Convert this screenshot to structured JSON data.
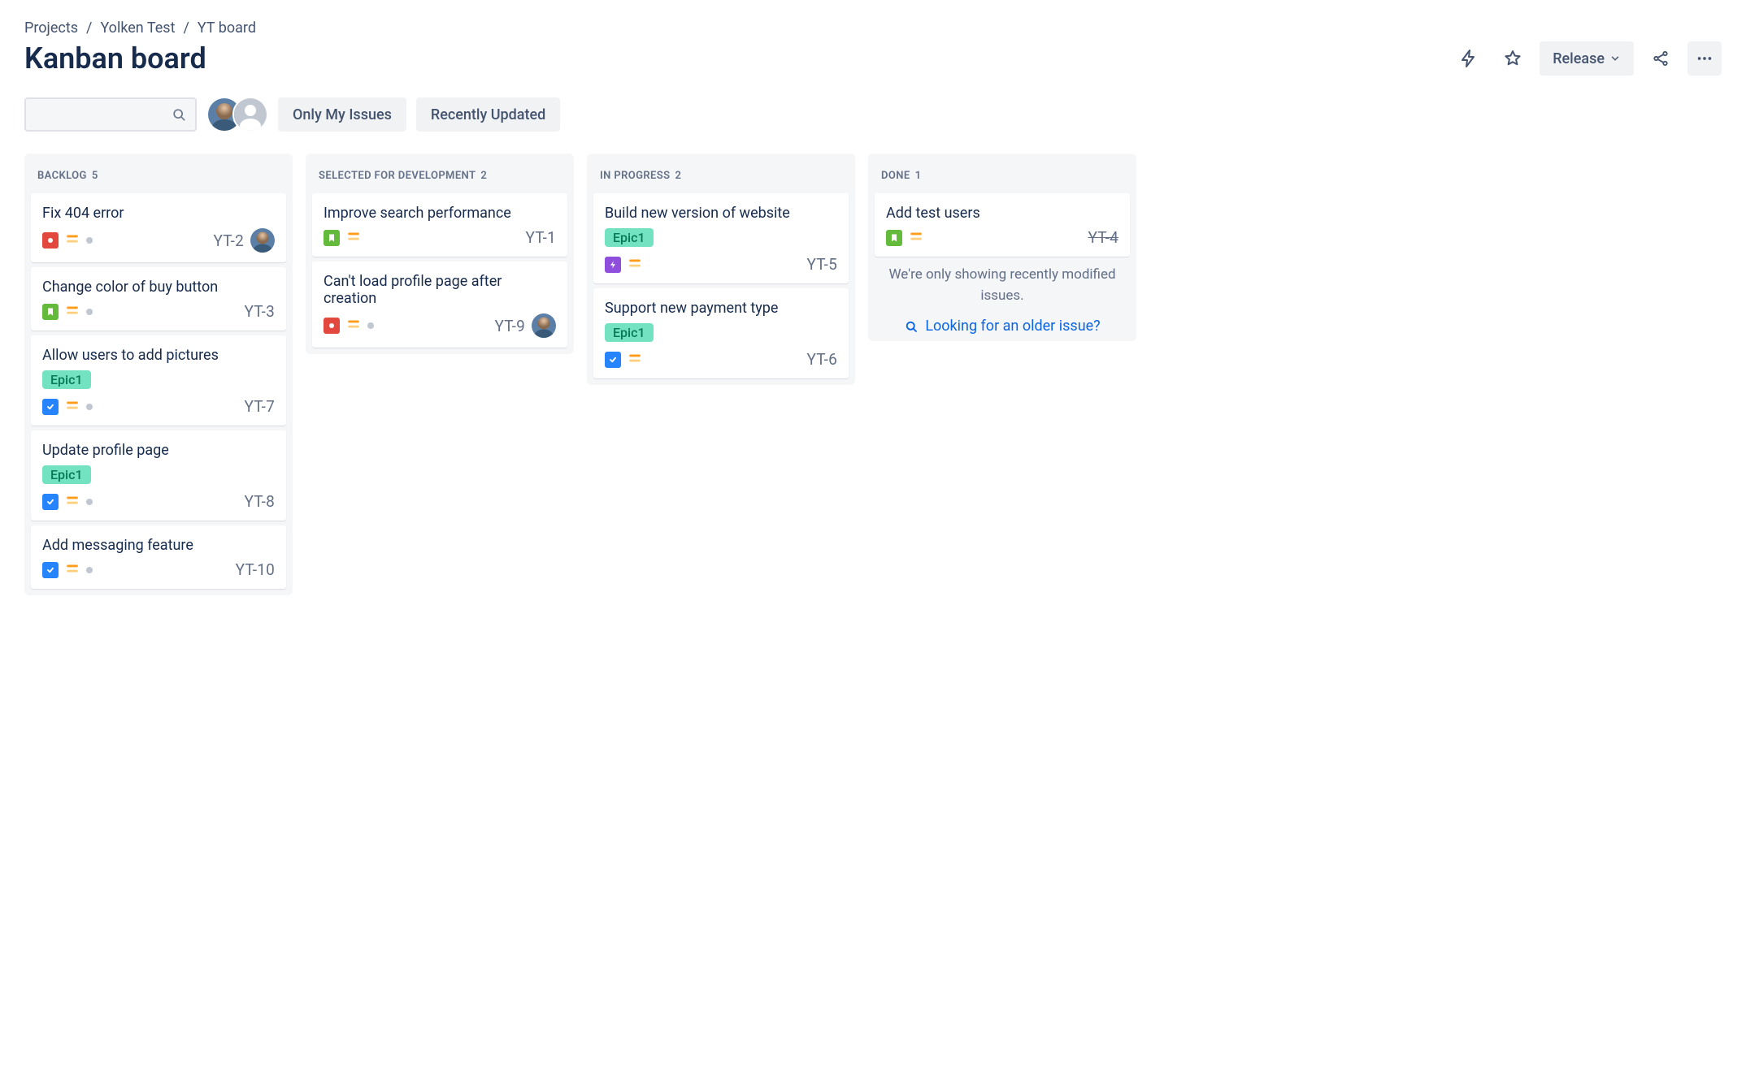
{
  "breadcrumbs": [
    "Projects",
    "Yolken Test",
    "YT board"
  ],
  "page_title": "Kanban board",
  "actions": {
    "release": "Release"
  },
  "filters": {
    "only_my": "Only My Issues",
    "recent": "Recently Updated"
  },
  "columns": [
    {
      "name": "Backlog",
      "count": 5,
      "cards": [
        {
          "title": "Fix 404 error",
          "key": "YT-2",
          "type": "bug",
          "priority": "medium",
          "flag": true,
          "avatar": "user1"
        },
        {
          "title": "Change color of buy button",
          "key": "YT-3",
          "type": "story",
          "priority": "medium",
          "flag": true
        },
        {
          "title": "Allow users to add pictures",
          "key": "YT-7",
          "type": "task",
          "epic": "Epic1",
          "priority": "medium",
          "flag": true
        },
        {
          "title": "Update profile page",
          "key": "YT-8",
          "type": "task",
          "epic": "Epic1",
          "priority": "medium",
          "flag": true
        },
        {
          "title": "Add messaging feature",
          "key": "YT-10",
          "type": "task",
          "priority": "medium",
          "flag": true
        }
      ]
    },
    {
      "name": "Selected for Development",
      "count": 2,
      "cards": [
        {
          "title": "Improve search performance",
          "key": "YT-1",
          "type": "story",
          "priority": "medium"
        },
        {
          "title": "Can't load profile page after creation",
          "key": "YT-9",
          "type": "bug",
          "priority": "medium",
          "flag": true,
          "avatar": "user1"
        }
      ]
    },
    {
      "name": "In Progress",
      "count": 2,
      "cards": [
        {
          "title": "Build new version of website",
          "key": "YT-5",
          "type": "epic",
          "epic": "Epic1",
          "priority": "medium"
        },
        {
          "title": "Support new payment type",
          "key": "YT-6",
          "type": "task",
          "epic": "Epic1",
          "priority": "medium"
        }
      ]
    },
    {
      "name": "Done",
      "count": 1,
      "cards": [
        {
          "title": "Add test users",
          "key": "YT-4",
          "type": "story",
          "priority": "medium",
          "done": true
        }
      ],
      "info": "We're only showing recently modified issues.",
      "older_link": "Looking for an older issue?"
    }
  ]
}
